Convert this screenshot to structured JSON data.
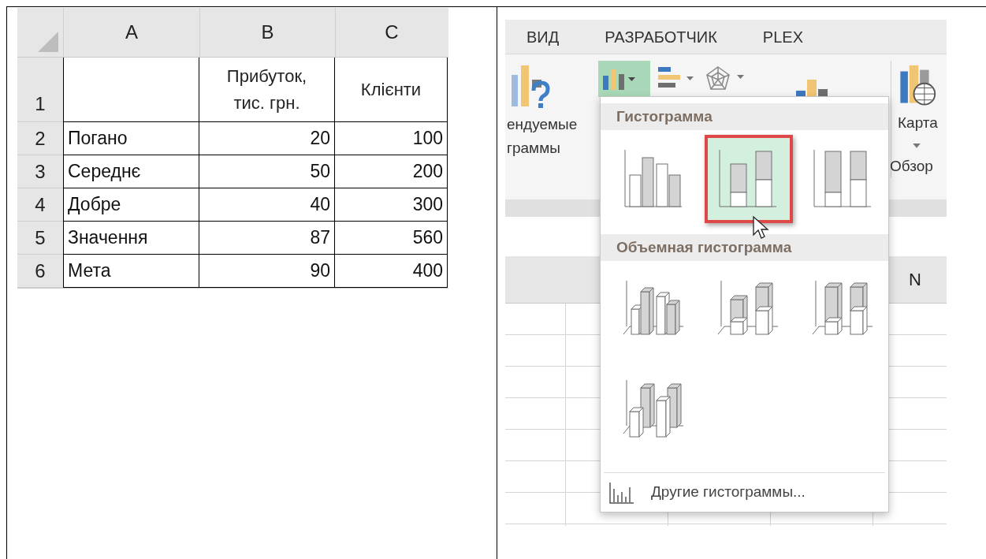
{
  "spreadsheet": {
    "columns": [
      "A",
      "B",
      "C"
    ],
    "header_row": {
      "number": "1",
      "b": "Прибуток, тис. грн.",
      "c": "Клієнти"
    },
    "rows": [
      {
        "number": "2",
        "a": "Погано",
        "b": "20",
        "c": "100"
      },
      {
        "number": "3",
        "a": "Середнє",
        "b": "50",
        "c": "200"
      },
      {
        "number": "4",
        "a": "Добре",
        "b": "40",
        "c": "300"
      },
      {
        "number": "5",
        "a": "Значення",
        "b": "87",
        "c": "560"
      },
      {
        "number": "6",
        "a": "Мета",
        "b": "90",
        "c": "400"
      }
    ]
  },
  "excel": {
    "ribbon_tabs": [
      "ВИД",
      "РАЗРАБОТЧИК",
      "PLEX"
    ],
    "recommended_label": [
      "ендуемые",
      "граммы"
    ],
    "column_chart_button": {
      "active": true
    },
    "map_button": {
      "label": "Карта"
    },
    "group_label": "Обзор",
    "sheet_column": "N",
    "menu": {
      "sections": [
        {
          "title": "Гистограмма",
          "items": [
            {
              "kind": "clustered",
              "selected": false
            },
            {
              "kind": "stacked",
              "selected": true
            },
            {
              "kind": "stacked100",
              "selected": false
            }
          ]
        },
        {
          "title": "Объемная гистограмма",
          "items": [
            {
              "kind": "clustered3d",
              "selected": false
            },
            {
              "kind": "stacked3d",
              "selected": false
            },
            {
              "kind": "stacked100_3d",
              "selected": false
            },
            {
              "kind": "column3d",
              "selected": false
            }
          ]
        }
      ],
      "footer": "Другие гистограммы..."
    }
  }
}
